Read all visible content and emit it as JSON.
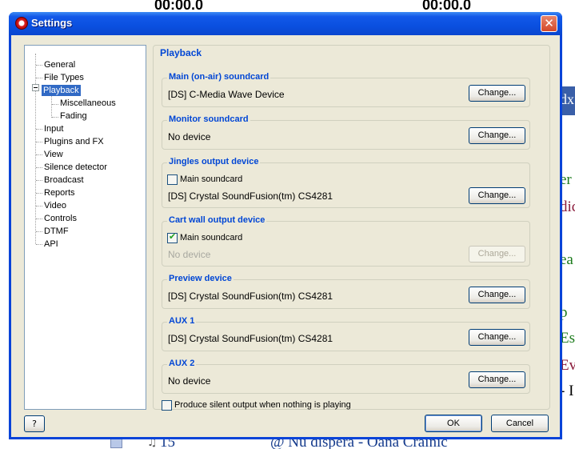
{
  "background": {
    "time_left": "00:00.0",
    "time_right": "00:00.0",
    "blue_text": "dx",
    "side_texts": [
      {
        "text": "er",
        "color": "#1a7a1a"
      },
      {
        "text": "dic",
        "color": "#8a1a3a"
      },
      {
        "text": "ea",
        "color": "#1a7a1a"
      },
      {
        "text": "p",
        "color": "#1a7a1a"
      },
      {
        "text": "Es",
        "color": "#1a7a1a"
      },
      {
        "text": "Ev",
        "color": "#8a1a3a"
      },
      {
        "text": "- I",
        "color": "#000000"
      }
    ],
    "bottom_number": "15",
    "bottom_song": "@ Nu dispera - Oana Crainic"
  },
  "window": {
    "title": "Settings",
    "close_glyph": "✕"
  },
  "tree": {
    "items": [
      "General",
      "File Types",
      "Playback",
      "Miscellaneous",
      "Fading",
      "Input",
      "Plugins and FX",
      "View",
      "Silence detector",
      "Broadcast",
      "Reports",
      "Video",
      "Controls",
      "DTMF",
      "API"
    ],
    "selected": "Playback"
  },
  "panel": {
    "title": "Playback",
    "groups": {
      "main": {
        "title": "Main (on-air) soundcard",
        "device": "[DS] C-Media Wave Device",
        "button": "Change..."
      },
      "monitor": {
        "title": "Monitor soundcard",
        "device": "No device",
        "button": "Change..."
      },
      "jingles": {
        "title": "Jingles output device",
        "checkbox_label": "Main soundcard",
        "checked": false,
        "device": "[DS] Crystal SoundFusion(tm) CS4281",
        "button": "Change..."
      },
      "cartwall": {
        "title": "Cart wall output device",
        "checkbox_label": "Main soundcard",
        "checked": true,
        "device": "No device",
        "button": "Change..."
      },
      "preview": {
        "title": "Preview device",
        "device": "[DS] Crystal SoundFusion(tm) CS4281",
        "button": "Change..."
      },
      "aux1": {
        "title": "AUX 1",
        "device": "[DS] Crystal SoundFusion(tm) CS4281",
        "button": "Change..."
      },
      "aux2": {
        "title": "AUX 2",
        "device": "No device",
        "button": "Change..."
      }
    },
    "silent_output_label": "Produce silent output when nothing is playing",
    "silent_output_checked": false
  },
  "buttons": {
    "help": "?",
    "ok": "OK",
    "cancel": "Cancel"
  }
}
